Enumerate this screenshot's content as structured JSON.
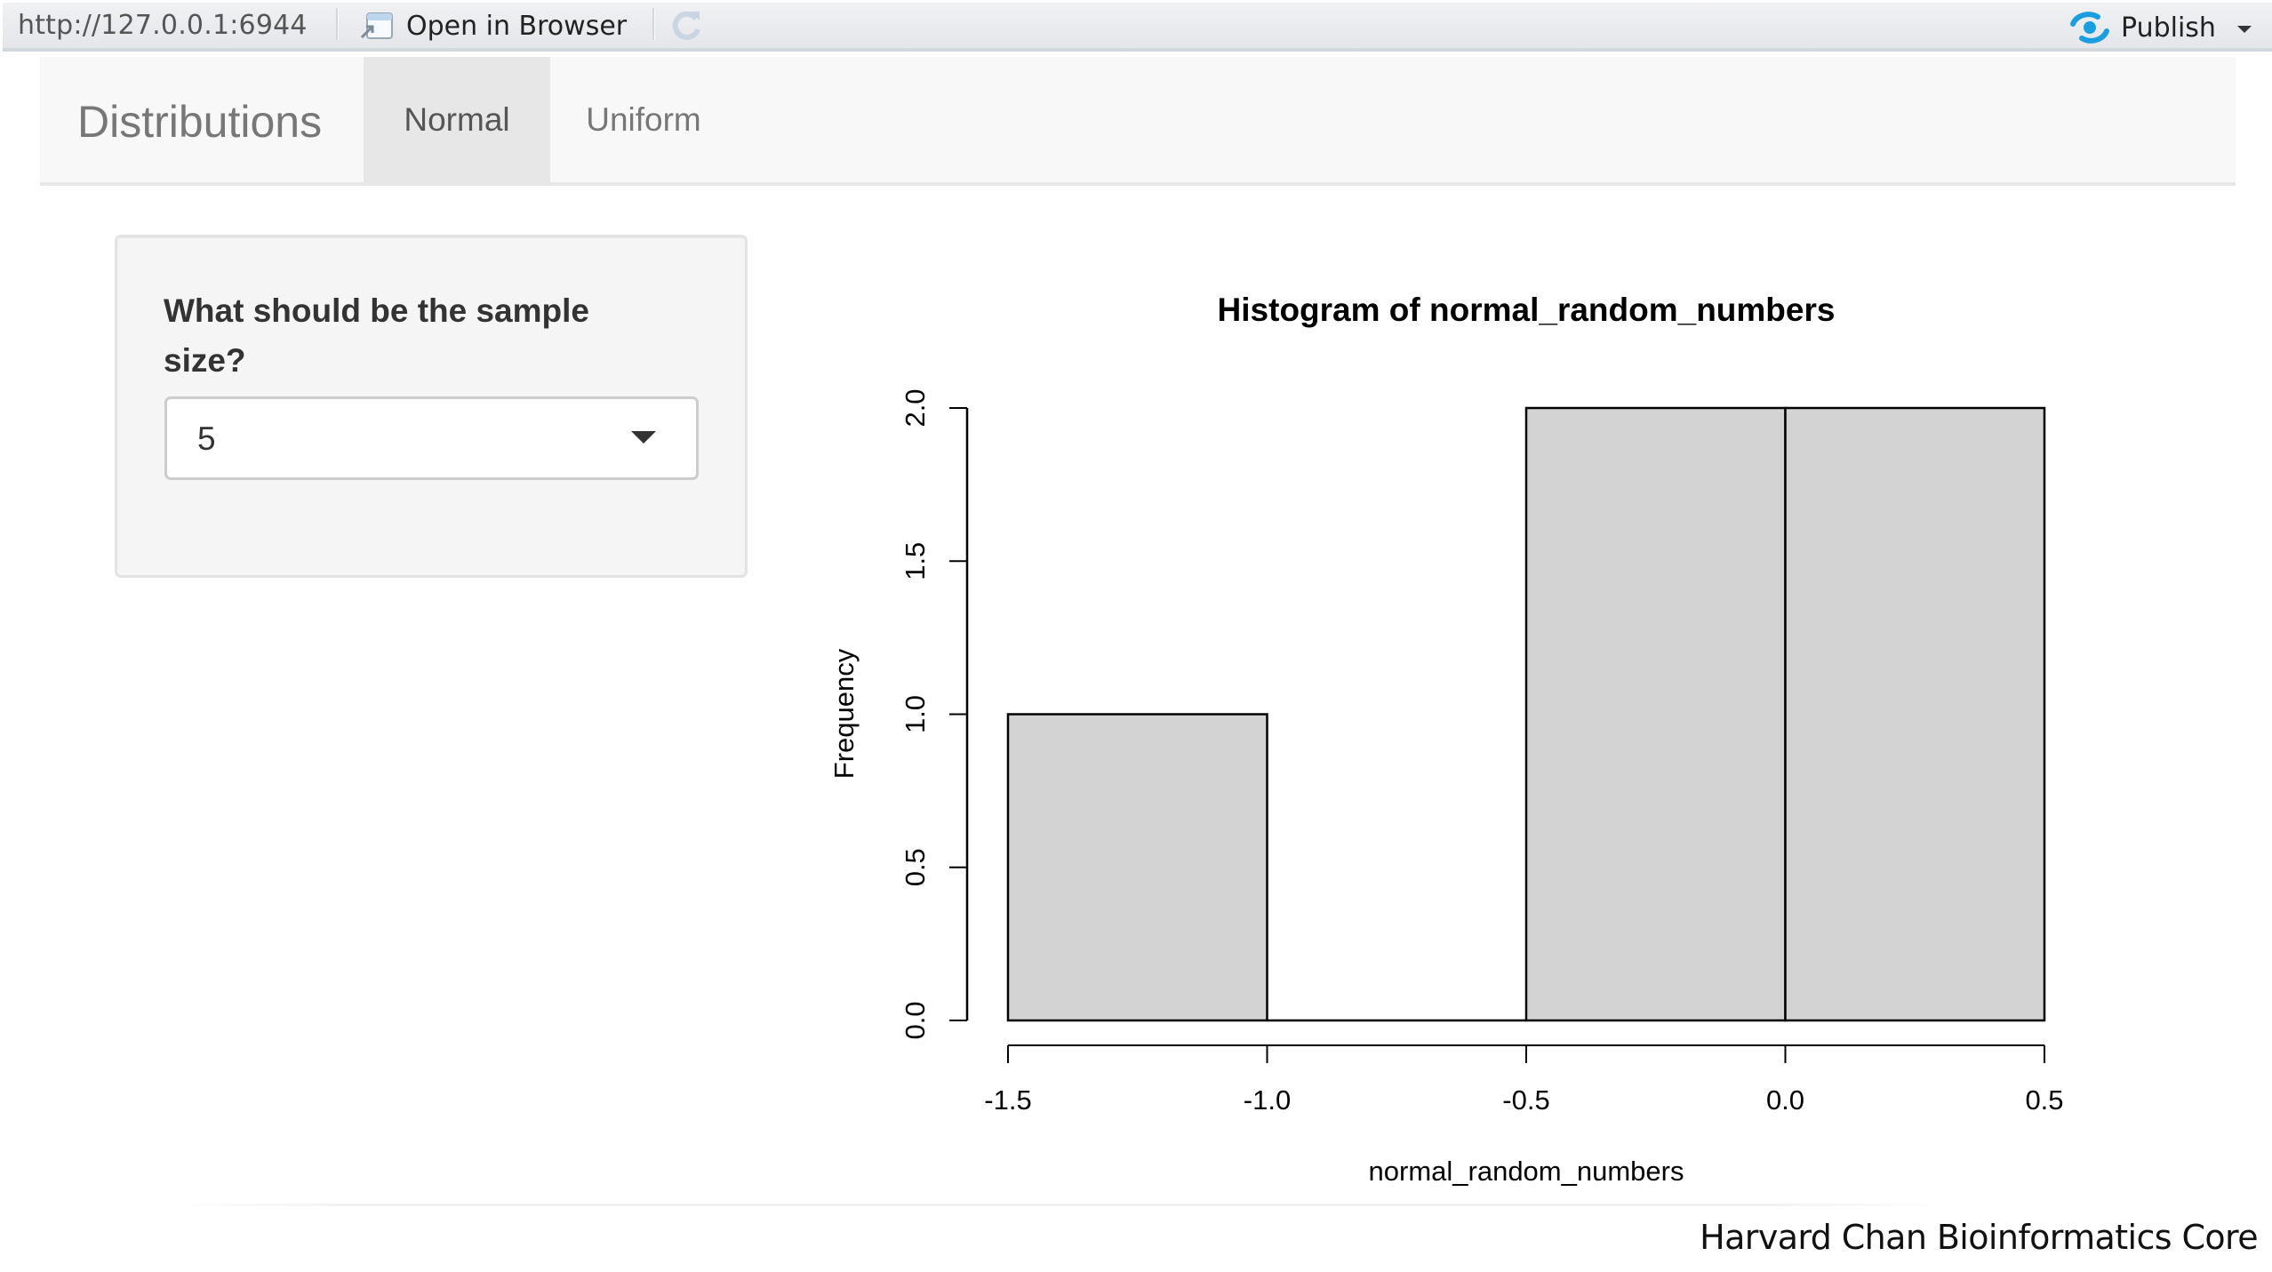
{
  "viewer_toolbar": {
    "url": "http://127.0.0.1:6944",
    "open_in_browser_label": "Open in Browser",
    "refresh_icon": "refresh-icon",
    "publish_label": "Publish",
    "publish_icon": "rstudio-connect-icon",
    "publish_accent": "#1a9ee0"
  },
  "navbar": {
    "brand": "Distributions",
    "tabs": [
      {
        "label": "Normal",
        "active": true
      },
      {
        "label": "Uniform",
        "active": false
      }
    ]
  },
  "sidebar": {
    "input_label": "What should be the sample size?",
    "select_value": "5"
  },
  "chart_data": {
    "type": "bar",
    "subtype": "histogram",
    "title": "Histogram of normal_random_numbers",
    "xlabel": "normal_random_numbers",
    "ylabel": "Frequency",
    "bins": [
      {
        "from": -1.5,
        "to": -1.0,
        "count": 1
      },
      {
        "from": -1.0,
        "to": -0.5,
        "count": 0
      },
      {
        "from": -0.5,
        "to": 0.0,
        "count": 2
      },
      {
        "from": 0.0,
        "to": 0.5,
        "count": 2
      }
    ],
    "xlim": [
      -1.5,
      0.5
    ],
    "ylim": [
      0,
      2
    ],
    "x_ticks": [
      -1.5,
      -1.0,
      -0.5,
      0.0,
      0.5
    ],
    "x_tick_labels": [
      "-1.5",
      "-1.0",
      "-0.5",
      "0.0",
      "0.5"
    ],
    "y_ticks": [
      0.0,
      0.5,
      1.0,
      1.5,
      2.0
    ],
    "y_tick_labels": [
      "0.0",
      "0.5",
      "1.0",
      "1.5",
      "2.0"
    ],
    "bar_fill": "#d3d3d3",
    "bar_stroke": "#000000",
    "grid": false,
    "legend": "none"
  },
  "footer": {
    "credit": "Harvard Chan Bioinformatics Core"
  }
}
